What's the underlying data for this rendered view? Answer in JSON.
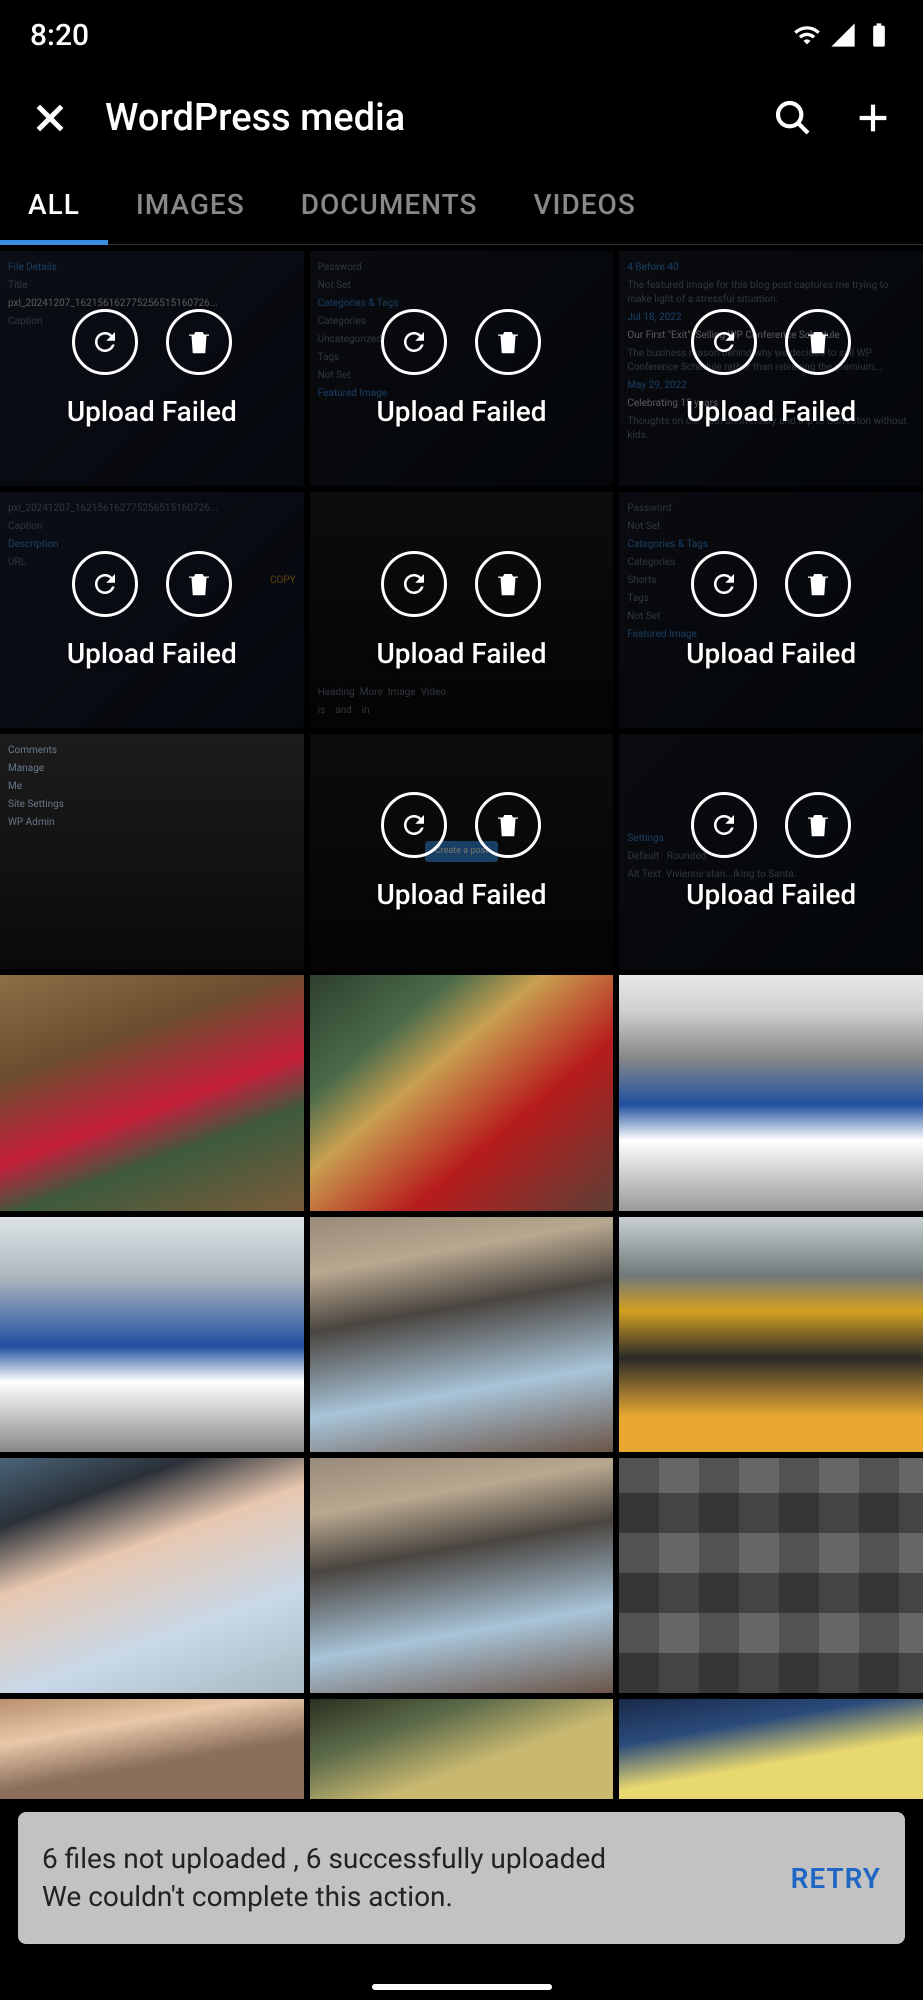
{
  "status": {
    "time": "8:20"
  },
  "appBar": {
    "title": "WordPress media",
    "closeIcon": "close-icon",
    "searchIcon": "search-icon",
    "addIcon": "plus-icon"
  },
  "tabs": [
    {
      "label": "ALL",
      "active": true
    },
    {
      "label": "IMAGES",
      "active": false
    },
    {
      "label": "DOCUMENTS",
      "active": false
    },
    {
      "label": "VIDEOS",
      "active": false
    }
  ],
  "failedLabel": "Upload Failed",
  "retryIcon": "retry-icon",
  "deleteIcon": "trash-icon",
  "media": [
    {
      "failed": true,
      "bg": "thumb-dark"
    },
    {
      "failed": true,
      "bg": "thumb-dark2"
    },
    {
      "failed": true,
      "bg": "thumb-dark2"
    },
    {
      "failed": true,
      "bg": "thumb-dark"
    },
    {
      "failed": true,
      "bg": "thumb-dark3"
    },
    {
      "failed": true,
      "bg": "thumb-dark2"
    },
    {
      "failed": false,
      "bg": "thumb-dark3",
      "noOverlay": true
    },
    {
      "failed": true,
      "bg": "thumb-dark3"
    },
    {
      "failed": true,
      "bg": "thumb-dark2"
    },
    {
      "failed": false,
      "bg": "photo-santa1"
    },
    {
      "failed": false,
      "bg": "photo-santa2"
    },
    {
      "failed": false,
      "bg": "photo-parade1"
    },
    {
      "failed": false,
      "bg": "photo-parade2"
    },
    {
      "failed": false,
      "bg": "photo-family1"
    },
    {
      "failed": false,
      "bg": "photo-float"
    },
    {
      "failed": false,
      "bg": "photo-selfie"
    },
    {
      "failed": false,
      "bg": "photo-family1"
    },
    {
      "failed": false,
      "bg": "photo-collage"
    },
    {
      "failed": false,
      "bg": "photo-partial1"
    },
    {
      "failed": false,
      "bg": "photo-partial2"
    },
    {
      "failed": false,
      "bg": "photo-partial3"
    }
  ],
  "mockText": {
    "fileDetails": "File Details",
    "title": "Title",
    "titleVal": "pxl_20241207_162156162775256515160726...",
    "caption": "Caption",
    "desc": "Description",
    "url": "URL",
    "password": "Password",
    "notSet": "Not Set",
    "categoriesTags": "Categories & Tags",
    "categories": "Categories",
    "uncategorized": "Uncategorized",
    "shorts": "Shorts",
    "tags": "Tags",
    "featured": "Featured Image",
    "comments": "Comments",
    "manage": "Manage",
    "me": "Me",
    "siteSettings": "Site Settings",
    "wpAdmin": "WP Admin",
    "before40": "4 Before 40",
    "before40Sub": "The featured image for this blog post captures me trying to make light of a stressful situation.",
    "post2Date": "Jul 18, 2022",
    "post2Title": "Our First \"Exit\": Selling WP Conference Schedule",
    "post2Sub": "The business reason behind why we decided to sell WP Conference Schedule rather than releasing the premium...",
    "post3Date": "May 29, 2022",
    "post3Title": "Celebrating 15 years",
    "post3Sub": "Thoughts on our 15th anniversary and trip to Galveston without kids.",
    "heading": "Heading",
    "more": "More",
    "image": "Image",
    "video": "Video",
    "isWord": "is",
    "andWord": "and",
    "inWord": "in",
    "createPost": "Create a post",
    "settings": "Settings",
    "default": "Default",
    "rounded": "Rounded",
    "altText": "Alt Text",
    "altVal": "Vivienne stan...lking to Santa.",
    "copy": "COPY"
  },
  "snackbar": {
    "line1": "6 files not uploaded , 6 successfully uploaded",
    "line2": "We couldn't complete this action.",
    "action": "RETRY"
  }
}
